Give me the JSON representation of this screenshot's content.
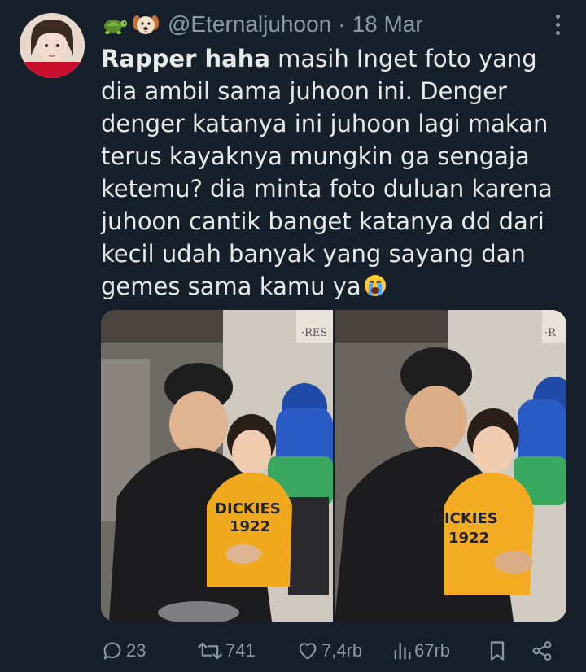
{
  "tweet": {
    "handle": "@Eternaljuhoon",
    "separator": "·",
    "date": "18 Mar",
    "author_emojis": [
      "turtle-emoji",
      "dog-face-emoji"
    ],
    "text_bold": "Rapper haha",
    "text_rest": " masih Inget foto yang dia ambil sama juhoon ini. Denger denger katanya ini juhoon lagi makan terus kayaknya mungkin ga sengaja ketemu? dia minta foto duluan karena juhoon cantik banget katanya dd dari kecil udah banyak yang sayang dan gemes sama kamu ya",
    "text_trailing_emoji": "loudly-crying-face-emoji",
    "hoodie_text_1": "DICKIES",
    "hoodie_text_2": "1922",
    "sign_text": "·RES",
    "sign_text_2": "·R"
  },
  "actions": {
    "replies": "23",
    "retweets": "741",
    "likes": "7,4rb",
    "views": "67rb"
  },
  "colors": {
    "background": "#15202b",
    "text": "#e7e9ea",
    "muted": "#8b98a5"
  }
}
